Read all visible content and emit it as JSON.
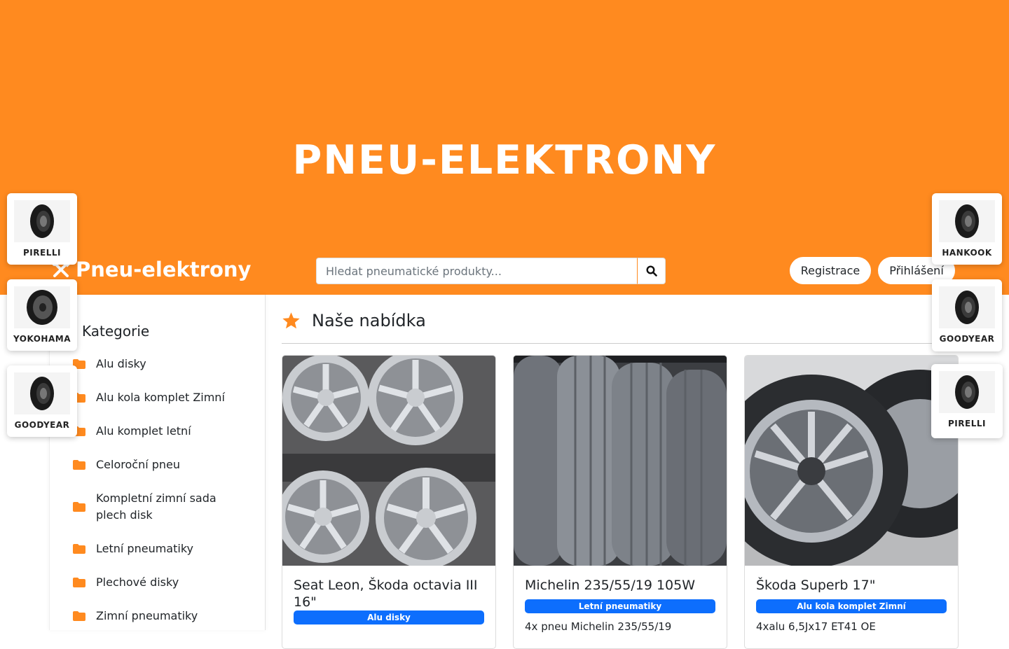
{
  "hero": {
    "title": "PNEU-ELEKTRONY"
  },
  "navbar": {
    "brand": "Pneu-elektrony",
    "search_placeholder": "Hledat pneumatické produkty...",
    "register": "Registrace",
    "login": "Přihlášení"
  },
  "sidebar": {
    "title": "Kategorie",
    "items": [
      "Alu disky",
      "Alu kola komplet Zimní",
      "Alu komplet letní",
      "Celoroční pneu",
      "Kompletní zimní sada plech disk",
      "Letní pneumatiky",
      "Plechové disky",
      "Zimní pneumatiky"
    ]
  },
  "main": {
    "title": "Naše nabídka",
    "products": [
      {
        "title": "Seat Leon, Škoda octavia III 16\"",
        "category": "Alu disky",
        "description": ""
      },
      {
        "title": "Michelin 235/55/19 105W",
        "category": "Letní pneumatiky",
        "description": "4x pneu Michelin 235/55/19"
      },
      {
        "title": "Škoda Superb 17\"",
        "category": "Alu kola komplet Zimní",
        "description": "4xalu 6,5Jx17 ET41 OE"
      }
    ]
  },
  "brands_left": [
    "PIRELLI",
    "YOKOHAMA",
    "GOODYEAR"
  ],
  "brands_right": [
    "HANKOOK",
    "GOODYEAR",
    "PIRELLI"
  ],
  "colors": {
    "accent": "#ff8a1f",
    "badge": "#0d6efd"
  }
}
